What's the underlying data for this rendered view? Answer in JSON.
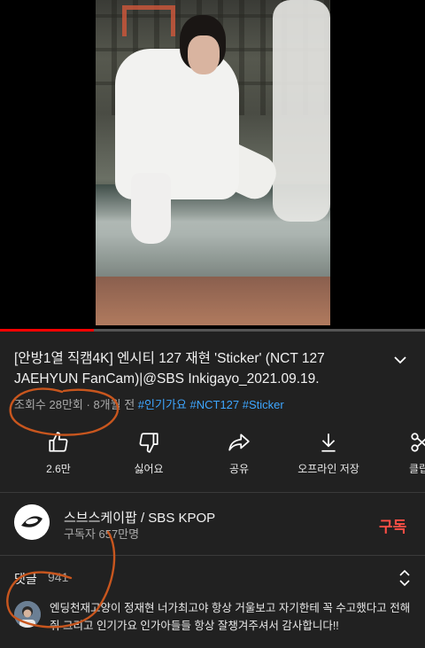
{
  "video": {
    "progress": 0.22,
    "title": "[안방1열 직캠4K] 엔시티 127 재현 'Sticker' (NCT 127 JAEHYUN FanCam)|@SBS Inkigayo_2021.09.19.",
    "views": "조회수 28만회",
    "separator": " · ",
    "age": "8개월 전",
    "tags": [
      "#인기가요",
      "#NCT127",
      "#Sticker"
    ]
  },
  "actions": [
    {
      "name": "like",
      "label": "2.6만",
      "icon": "thumbs-up-icon"
    },
    {
      "name": "dislike",
      "label": "싫어요",
      "icon": "thumbs-down-icon"
    },
    {
      "name": "share",
      "label": "공유",
      "icon": "share-icon"
    },
    {
      "name": "download",
      "label": "오프라인 저장",
      "icon": "download-icon"
    },
    {
      "name": "clip",
      "label": "클립",
      "icon": "scissors-icon"
    }
  ],
  "channel": {
    "name": "스브스케이팝 / SBS KPOP",
    "subscribers": "구독자 657만명",
    "subscribe_label": "구독"
  },
  "comments": {
    "header": "댓글",
    "count": "941",
    "first_comment": "엔딩천재고양이 정재현 너가최고야 항상 거울보고 자기한테 꼭 수고했다고 전해줘 그리고 인기가요 인가아들들 항상 잘챙겨주셔서 감사합니다!!"
  },
  "colors": {
    "background": "#212121",
    "link": "#3ea6ff",
    "subscribe": "#ff4e45",
    "annotation": "#c8561e"
  }
}
